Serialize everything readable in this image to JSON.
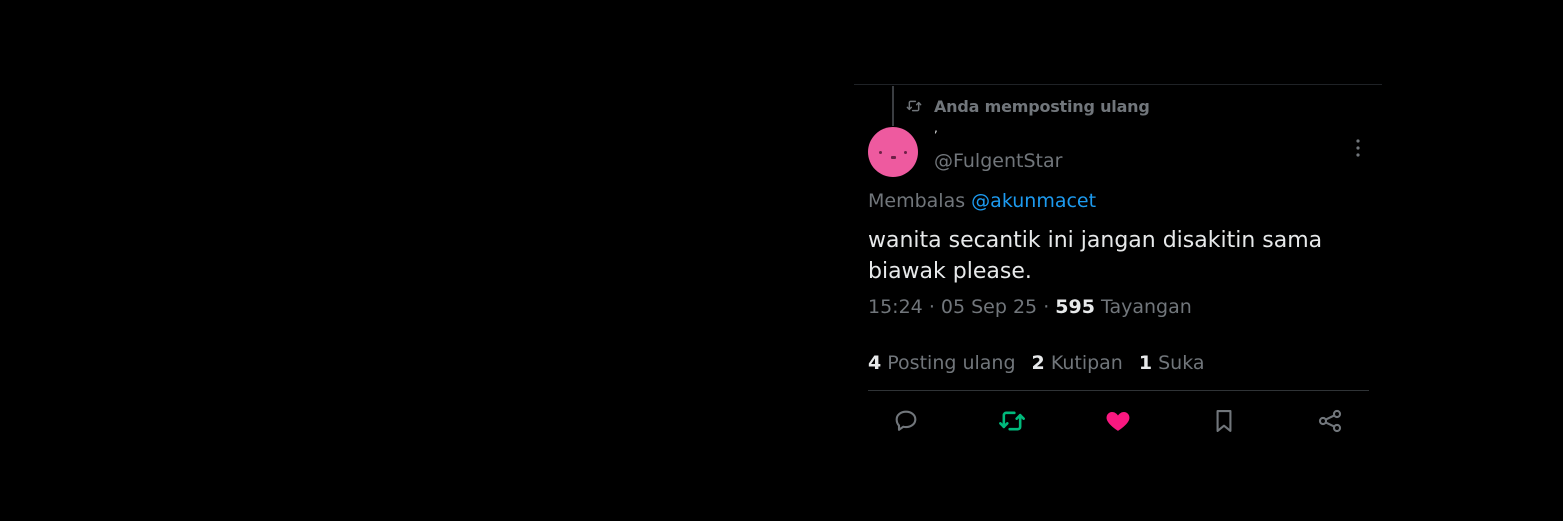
{
  "tweet": {
    "repost_label": "Anda memposting ulang",
    "display_name": ",",
    "handle": "@FulgentStar",
    "reply_prefix": "Membalas",
    "reply_to": "@akunmacet",
    "text": "wanita secantik ini jangan disakitin sama biawak please.",
    "time": "15:24",
    "date": "05 Sep 25",
    "separator": "·",
    "views_count": "595",
    "views_label": "Tayangan",
    "stats": {
      "reposts_count": "4",
      "reposts_label": "Posting ulang",
      "quotes_count": "2",
      "quotes_label": "Kutipan",
      "likes_count": "1",
      "likes_label": "Suka"
    },
    "actions": [
      {
        "name": "reply",
        "icon": "reply-icon"
      },
      {
        "name": "repost",
        "icon": "repost-icon",
        "active": true
      },
      {
        "name": "like",
        "icon": "heart-icon",
        "active": true
      },
      {
        "name": "bookmark",
        "icon": "bookmark-icon"
      },
      {
        "name": "share",
        "icon": "share-icon"
      }
    ]
  },
  "colors": {
    "background": "#000000",
    "text_primary": "#e7e9ea",
    "text_secondary": "#71767b",
    "link": "#1d9bf0",
    "repost_active": "#00ba7c",
    "like_active": "#f91880",
    "avatar": "#ee5a9f"
  }
}
